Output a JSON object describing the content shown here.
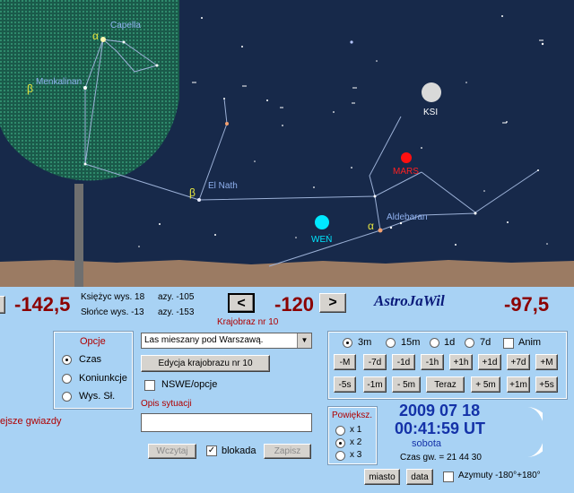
{
  "sky": {
    "stars_labels": {
      "capella": "Capella",
      "menkalinan": "Menkalinan",
      "elnath": "El Nath",
      "aldebaran": "Aldebaran",
      "ksi": "KSI",
      "mars": "MARS",
      "wen": "WEŃ",
      "alpha1": "α",
      "beta1": "β",
      "beta2": "β",
      "alpha2": "α"
    },
    "colors": {
      "sky": "#17294a",
      "ground": "#9b7b63",
      "constellation": "#9bb0d6",
      "label": "#8fb0ee",
      "mars": "#ff1010",
      "wen": "#00e8ff"
    }
  },
  "panel": {
    "left_value": "-142,5",
    "center_value": "-120",
    "right_value": "-97,5",
    "nav_prev": "<",
    "nav_next": ">",
    "moon_line": "Księżyc wys. 18",
    "moon_az": "azy. -105",
    "sun_line": "Słońce wys. -13",
    "sun_az": "azy. -153",
    "app_title": "AstroJaWil",
    "landscape_label": "Krajobraz nr 10",
    "landscape_select": "Las mieszany pod Warszawą.",
    "edit_landscape": "Edycja krajobrazu nr 10",
    "nswe_label": "NSWE/opcje",
    "description_label": "Opis sytuacji",
    "description_value": "",
    "load_btn": "Wczytaj",
    "lock_label": "blokada",
    "save_btn": "Zapisz",
    "left_text": "ejsze gwiazdy",
    "options": {
      "title": "Opcje",
      "items": [
        "Czas",
        "Koniunkcje",
        "Wys. Sł."
      ],
      "selected": 0
    },
    "step": {
      "items": [
        "3m",
        "15m",
        "1d",
        "7d"
      ],
      "selected": 0,
      "anim": "Anim"
    },
    "buttons_row1": [
      "-M",
      "-7d",
      "-1d",
      "-1h",
      "+1h",
      "+1d",
      "+7d",
      "+M"
    ],
    "buttons_row2": [
      "-5s",
      "-1m",
      "- 5m",
      "Teraz",
      "+ 5m",
      "+1m",
      "+5s"
    ],
    "zoom": {
      "title": "Powiększ.",
      "items": [
        "x 1",
        "x 2",
        "x 3"
      ],
      "selected": 1
    },
    "date": "2009 07 18",
    "time": "00:41:59 UT",
    "weekday": "sobota",
    "sidereal": "Czas gw. =   21 44 30",
    "city_btn": "miasto",
    "date_btn": "data",
    "azimuth_label": "Azymuty -180°+180°"
  }
}
